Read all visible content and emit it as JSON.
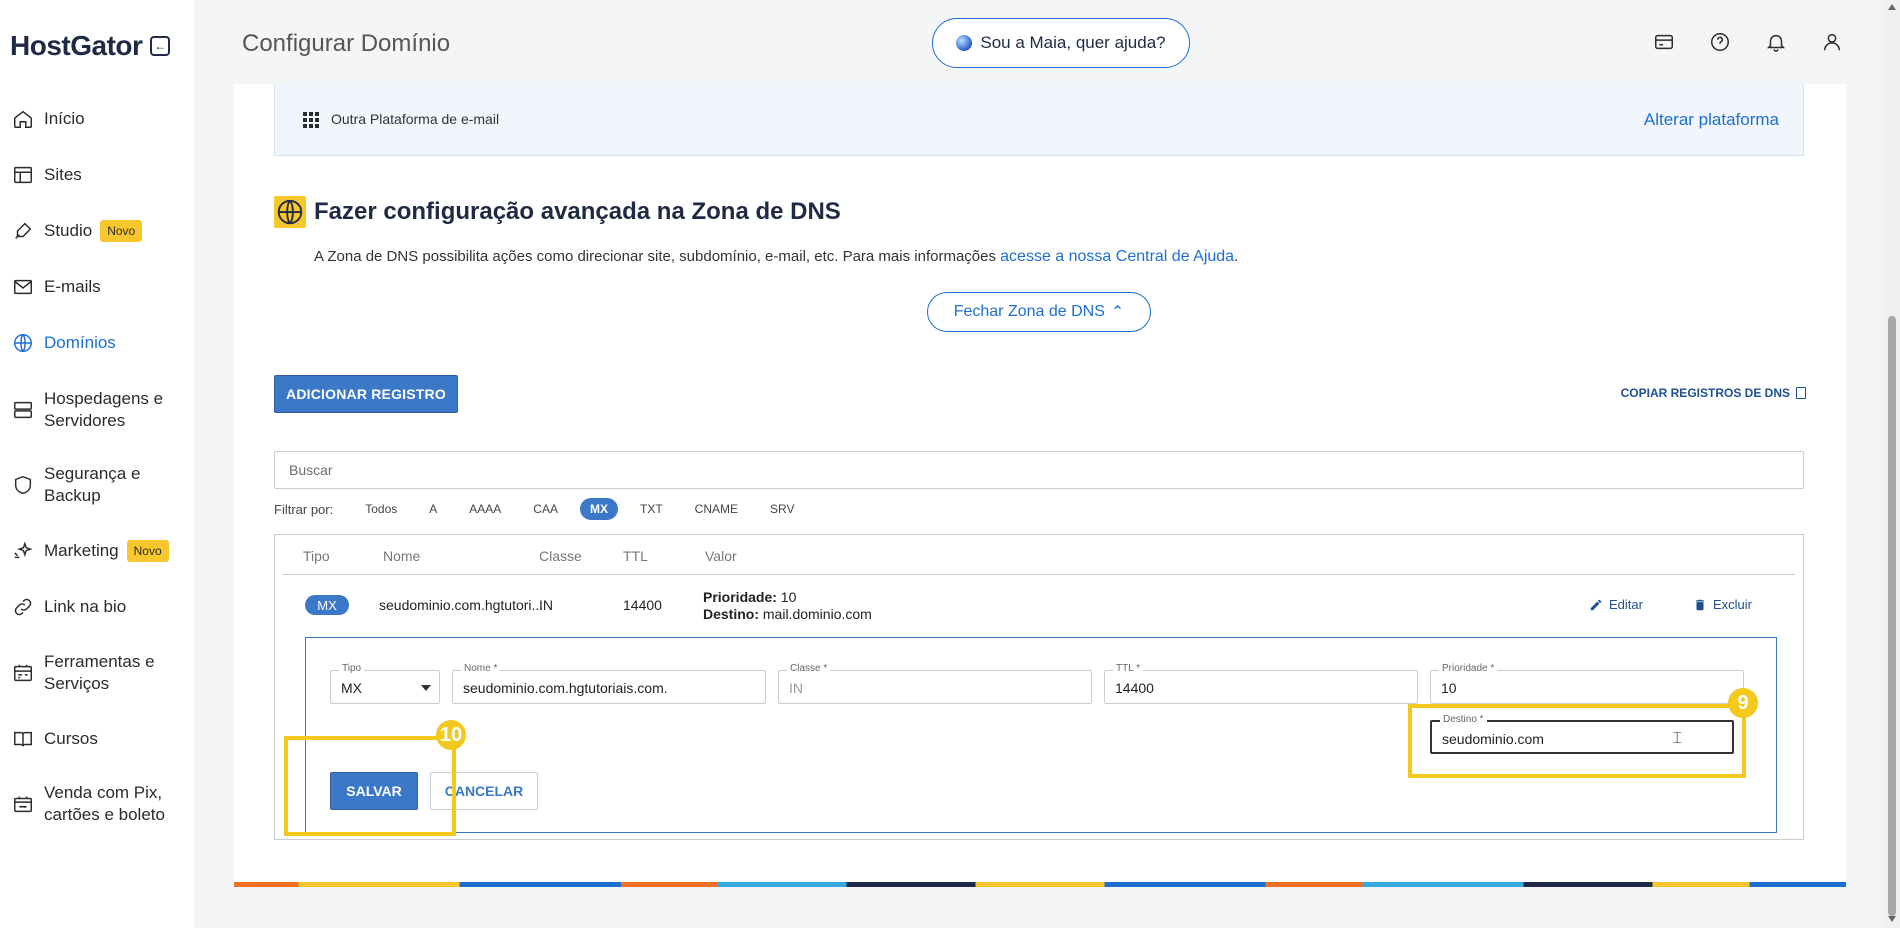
{
  "sidebar": {
    "logo": "HostGator",
    "items": [
      {
        "label": "Início",
        "icon": "home-icon"
      },
      {
        "label": "Sites",
        "icon": "layout-icon"
      },
      {
        "label": "Studio",
        "icon": "brush-icon",
        "badge": "Novo"
      },
      {
        "label": "E-mails",
        "icon": "mail-icon"
      },
      {
        "label": "Domínios",
        "icon": "globe-icon",
        "active": true
      },
      {
        "label": "Hospedagens e",
        "label2": "Servidores",
        "icon": "server-icon"
      },
      {
        "label": "Segurança e",
        "label2": "Backup",
        "icon": "shield-icon"
      },
      {
        "label": "Marketing",
        "icon": "sparkle-icon",
        "badge": "Novo"
      },
      {
        "label": "Link na bio",
        "icon": "link-icon"
      },
      {
        "label": "Ferramentas e",
        "label2": "Serviços",
        "icon": "tools-icon"
      },
      {
        "label": "Cursos",
        "icon": "book-icon"
      },
      {
        "label": "Venda com Pix,",
        "label2": "cartões e boleto",
        "icon": "payment-icon"
      }
    ]
  },
  "header": {
    "title": "Configurar Domínio",
    "maia_label": "Sou a Maia, quer ajuda?"
  },
  "platform": {
    "label": "Outra Plataforma de e-mail",
    "change_link": "Alterar plataforma"
  },
  "dns": {
    "title": "Fazer configuração avançada na Zona de DNS",
    "desc": "A Zona de DNS possibilita ações como direcionar site, subdomínio, e-mail, etc. Para mais informações ",
    "desc_link": "acesse a nossa Central de Ajuda",
    "desc_end": ".",
    "close_label": "Fechar Zona de DNS",
    "add_label": "ADICIONAR REGISTRO",
    "copy_label": "COPIAR REGISTROS DE DNS",
    "search_placeholder": "Buscar",
    "filter_label": "Filtrar por:",
    "filters": [
      "Todos",
      "A",
      "AAAA",
      "CAA",
      "MX",
      "TXT",
      "CNAME",
      "SRV"
    ],
    "active_filter": "MX"
  },
  "table": {
    "headers": [
      "Tipo",
      "Nome",
      "Classe",
      "TTL",
      "Valor"
    ],
    "row": {
      "tipo": "MX",
      "nome": "seudominio.com.hgtutori...",
      "classe": "IN",
      "ttl": "14400",
      "prioridade_label": "Prioridade:",
      "prioridade": "10",
      "destino_label": "Destino:",
      "destino": "mail.dominio.com",
      "edit_label": "Editar",
      "delete_label": "Excluir"
    }
  },
  "edit": {
    "tipo_label": "Tipo",
    "tipo_value": "MX",
    "nome_label": "Nome *",
    "nome_value": "seudominio.com.hgtutoriais.com.",
    "classe_label": "Classe *",
    "classe_value": "IN",
    "ttl_label": "TTL *",
    "ttl_value": "14400",
    "prioridade_label": "Prioridade *",
    "prioridade_value": "10",
    "destino_label": "Destino *",
    "destino_value": "seudominio.com",
    "save_label": "SALVAR",
    "cancel_label": "CANCELAR"
  },
  "highlights": {
    "step_save": "10",
    "step_destino": "9"
  },
  "colors": {
    "accent": "#1c6fd1",
    "highlight": "#f2c91c",
    "badge": "#f7c72b"
  }
}
